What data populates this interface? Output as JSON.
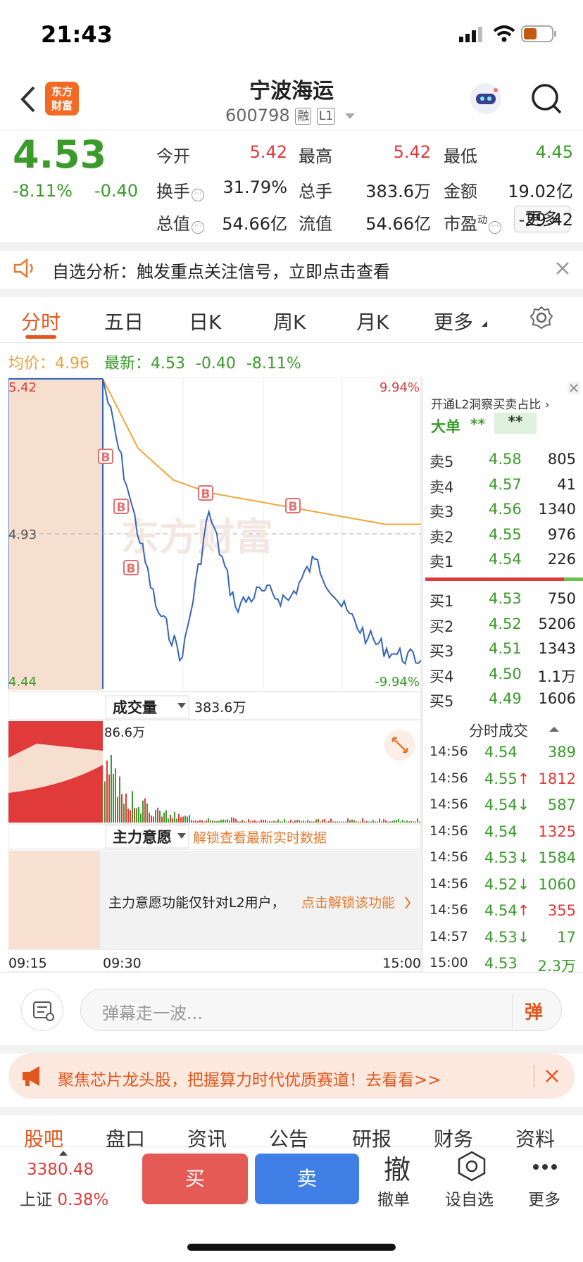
{
  "status": {
    "time": "21:43"
  },
  "header": {
    "title": "宁波海运",
    "code": "600798",
    "tag1": "融",
    "tag2": "L1",
    "logo_line1": "东方",
    "logo_line2": "财富"
  },
  "quote": {
    "price": "4.53",
    "pct": "-8.11%",
    "chg": "-0.40",
    "stats": [
      {
        "label": "今开",
        "value": "5.42",
        "color": "red"
      },
      {
        "label": "最高",
        "value": "5.42",
        "color": "red"
      },
      {
        "label": "最低",
        "value": "4.45",
        "color": "green"
      },
      {
        "label": "换手",
        "value": "31.79%",
        "color": "dark"
      },
      {
        "label": "总手",
        "value": "383.6万",
        "color": "dark"
      },
      {
        "label": "金额",
        "value": "19.02亿",
        "color": "dark"
      },
      {
        "label": "总值",
        "value": "54.66亿",
        "color": "dark"
      },
      {
        "label": "流值",
        "value": "54.66亿",
        "color": "dark"
      },
      {
        "label": "市盈",
        "sup": "动",
        "value": "-29.42",
        "color": "dark"
      }
    ],
    "more": "更多"
  },
  "banner": {
    "text": "自选分析：触发重点关注信号，立即点击查看"
  },
  "tabs": [
    "分时",
    "五日",
    "日K",
    "周K",
    "月K",
    "更多"
  ],
  "summary": {
    "avg_label": "均价：",
    "avg": "4.96",
    "latest_label": "最新：",
    "latest": "4.53",
    "chg": "-0.40",
    "pct": "-8.11%"
  },
  "chart": {
    "y_top": "5.42",
    "y_mid": "4.93",
    "y_bot": "4.44",
    "pct_top": "9.94%",
    "pct_bot": "-9.94%",
    "watermark": "东方财富",
    "buy_marker": "B",
    "vol_label": "成交量",
    "vol_total": "383.6万",
    "vol_max": "86.6万",
    "main_label": "主力意愿",
    "main_unlock": "解锁查看最新实时数据",
    "main_msg": "主力意愿功能仅针对L2用户，",
    "main_link": "点击解锁该功能",
    "x_labels": [
      "09:15",
      "09:30",
      "15:00"
    ]
  },
  "chart_data": {
    "type": "line",
    "title": "",
    "x": [
      "09:15",
      "09:30",
      "15:00"
    ],
    "ylim": [
      4.44,
      5.42
    ],
    "ref_price": 4.93,
    "series": [
      {
        "name": "最新",
        "values": [
          5.42,
          5.05,
          4.7,
          4.54,
          5.0,
          4.7,
          4.75,
          4.72,
          4.85,
          4.7,
          4.6,
          4.55,
          4.53
        ]
      },
      {
        "name": "均价",
        "values": [
          5.42,
          5.2,
          5.1,
          5.06,
          5.04,
          5.02,
          5.0,
          4.98,
          4.96,
          4.96
        ]
      }
    ]
  },
  "orderbook": {
    "promo": "开通L2洞察买卖占比",
    "big_label": "大单",
    "big_val1": "**",
    "big_val2": "**",
    "asks": [
      {
        "label": "卖5",
        "price": "4.58",
        "vol": "805"
      },
      {
        "label": "卖4",
        "price": "4.57",
        "vol": "41"
      },
      {
        "label": "卖3",
        "price": "4.56",
        "vol": "1340"
      },
      {
        "label": "卖2",
        "price": "4.55",
        "vol": "976"
      },
      {
        "label": "卖1",
        "price": "4.54",
        "vol": "226"
      }
    ],
    "bids": [
      {
        "label": "买1",
        "price": "4.53",
        "vol": "750"
      },
      {
        "label": "买2",
        "price": "4.52",
        "vol": "5206"
      },
      {
        "label": "买3",
        "price": "4.51",
        "vol": "1343"
      },
      {
        "label": "买4",
        "price": "4.50",
        "vol": "1.1万"
      },
      {
        "label": "买5",
        "price": "4.49",
        "vol": "1606"
      }
    ],
    "ticks_title": "分时成交",
    "ticks": [
      {
        "time": "14:56",
        "price": "4.54",
        "arrow": "",
        "vol": "389",
        "vc": "green"
      },
      {
        "time": "14:56",
        "price": "4.55",
        "arrow": "↑",
        "vol": "1812",
        "vc": "red"
      },
      {
        "time": "14:56",
        "price": "4.54",
        "arrow": "↓",
        "vol": "587",
        "vc": "green"
      },
      {
        "time": "14:56",
        "price": "4.54",
        "arrow": "",
        "vol": "1325",
        "vc": "red"
      },
      {
        "time": "14:56",
        "price": "4.53",
        "arrow": "↓",
        "vol": "1584",
        "vc": "green"
      },
      {
        "time": "14:56",
        "price": "4.52",
        "arrow": "↓",
        "vol": "1060",
        "vc": "green"
      },
      {
        "time": "14:56",
        "price": "4.54",
        "arrow": "↑",
        "vol": "355",
        "vc": "red"
      },
      {
        "time": "14:57",
        "price": "4.53",
        "arrow": "↓",
        "vol": "17",
        "vc": "green"
      },
      {
        "time": "15:00",
        "price": "4.53",
        "arrow": "",
        "vol": "2.3万",
        "vc": "green"
      }
    ]
  },
  "comment": {
    "placeholder": "弹幕走一波...",
    "btn": "弹"
  },
  "ad": {
    "text": "聚焦芯片龙头股，把握算力时代优质赛道！去看看>>"
  },
  "bottom_tabs": [
    "股吧",
    "盘口",
    "资讯",
    "公告",
    "研报",
    "财务",
    "资料"
  ],
  "footer": {
    "index_val": "3380.48",
    "index_name": "上证",
    "index_pct": "0.38%",
    "buy": "买",
    "sell": "卖",
    "cancel_icon": "撤",
    "cancel": "撤单",
    "watch": "设自选",
    "more": "更多"
  }
}
